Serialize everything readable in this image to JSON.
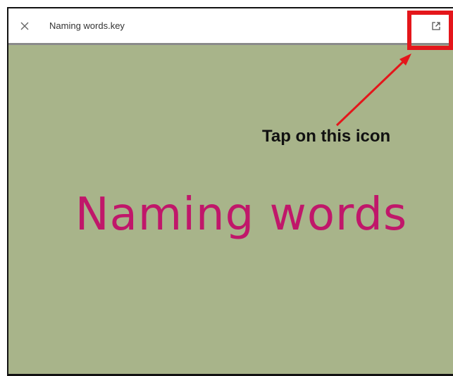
{
  "toolbar": {
    "close_icon": "close-icon",
    "file_title": "Naming words.key",
    "open_external_icon": "open-external-icon"
  },
  "slide": {
    "title": "Naming words",
    "background_color": "#a8b48a",
    "title_color": "#c0176a"
  },
  "annotation": {
    "callout_text": "Tap on this icon",
    "highlight_color": "#e4161b"
  }
}
